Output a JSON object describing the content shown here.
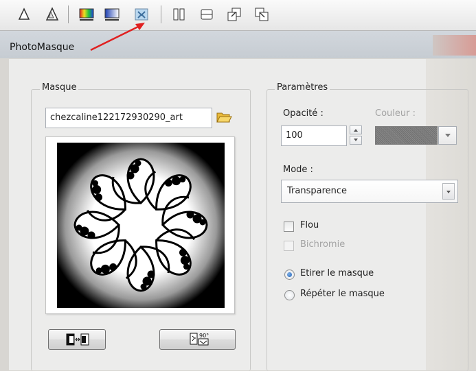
{
  "toolbar": {
    "icons": [
      "triangle-outline-icon",
      "triangle-outline-icon",
      "color-balance-icon",
      "monitor-gradient-icon",
      "photomask-icon",
      "shape-columns-icon",
      "layer-merge-icon",
      "arrange-forward-icon",
      "arrange-backward-icon"
    ]
  },
  "window": {
    "title": "PhotoMasque"
  },
  "mask_panel": {
    "heading": "Masque",
    "filename": "chezcaline122172930290_art",
    "invert_button_icon": "invert-mask-icon",
    "rotate_button_icon": "rotate-90-icon"
  },
  "params": {
    "heading": "Paramètres",
    "opacity_label": "Opacité :",
    "opacity_value": "100",
    "color_label": "Couleur :",
    "color_swatch": "#7c7c7c",
    "mode_label": "Mode :",
    "mode_value": "Transparence",
    "blur_label": "Flou",
    "bichrome_label": "Bichromie",
    "stretch_label": "Etirer le masque",
    "repeat_label": "Répéter le masque"
  },
  "colors": {
    "arrow_annotation": "#e02020",
    "radio_accent": "#2d6cc0"
  }
}
